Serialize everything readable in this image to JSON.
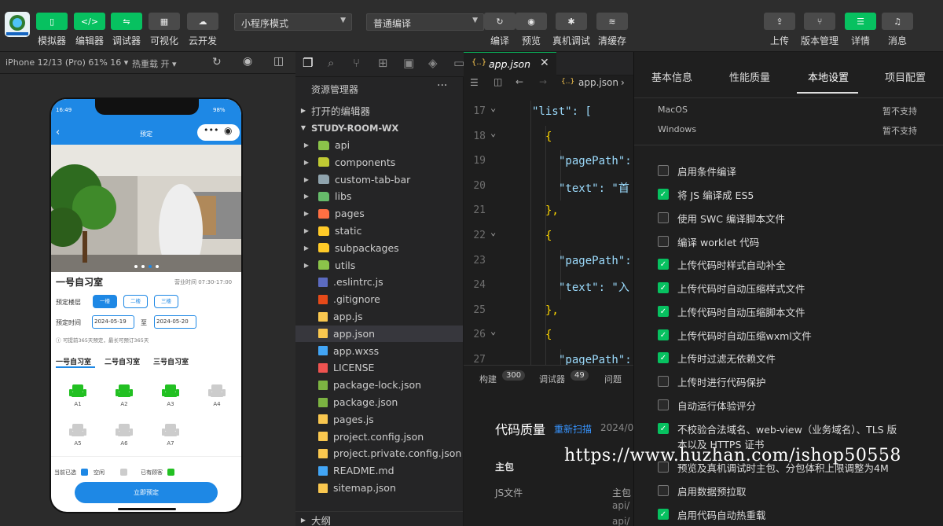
{
  "toolbar": {
    "left_buttons": [
      {
        "label": "模拟器",
        "icon": "phone-icon",
        "glyph": "▯"
      },
      {
        "label": "编辑器",
        "icon": "code-icon",
        "glyph": "</>"
      },
      {
        "label": "调试器",
        "icon": "debug-icon",
        "glyph": "⇋"
      },
      {
        "label": "可视化",
        "icon": "layout-icon",
        "glyph": "▦"
      },
      {
        "label": "云开发",
        "icon": "cloud-icon",
        "glyph": "☁"
      }
    ],
    "mode_select": "小程序模式",
    "compile_select": "普通编译",
    "mid_buttons": [
      {
        "label": "编译",
        "icon": "refresh-icon",
        "glyph": "↻"
      },
      {
        "label": "预览",
        "icon": "eye-icon",
        "glyph": "◉"
      },
      {
        "label": "真机调试",
        "icon": "bug-icon",
        "glyph": "✱"
      },
      {
        "label": "清缓存",
        "icon": "layers-icon",
        "glyph": "≋"
      }
    ],
    "right_buttons": [
      {
        "label": "上传",
        "icon": "upload-icon",
        "glyph": "⇪"
      },
      {
        "label": "版本管理",
        "icon": "branch-icon",
        "glyph": "⑂"
      },
      {
        "label": "详情",
        "icon": "menu-icon",
        "glyph": "☰"
      },
      {
        "label": "消息",
        "icon": "bell-icon",
        "glyph": "♫"
      }
    ]
  },
  "simulator": {
    "device": "iPhone 12/13 (Pro) 61% 16 ▾",
    "hot_reload": "热重载 开 ▾",
    "phone": {
      "time": "16:49",
      "battery": "98%",
      "nav_title": "预定",
      "room_name": "一号自习室",
      "hours": "营业时间 07:30-17:00",
      "floor_label": "预定楼层",
      "floors": [
        "一楼",
        "二楼",
        "三楼"
      ],
      "time_label": "预定时间",
      "date_from": "2024-05-19",
      "date_to_sep": "至",
      "date_to": "2024-05-20",
      "tip": "可提前365天预定，最长可预订365天",
      "room_tabs": [
        "一号自习室",
        "二号自习室",
        "三号自习室"
      ],
      "seats": [
        {
          "id": "A1",
          "state": "mine"
        },
        {
          "id": "A2",
          "state": "mine"
        },
        {
          "id": "A3",
          "state": "mine"
        },
        {
          "id": "A4",
          "state": "free"
        },
        {
          "id": "A5",
          "state": "free"
        },
        {
          "id": "A6",
          "state": "free"
        },
        {
          "id": "A7",
          "state": "free"
        }
      ],
      "legend": [
        "当前已选",
        "空闲",
        "已有顾客"
      ],
      "book_button": "立即预定",
      "colors": {
        "selected": "#1e88e5",
        "free": "#cccccc",
        "occupied": "#22c022"
      }
    }
  },
  "activity_icons": [
    "files-icon",
    "search-icon",
    "source-control-icon",
    "extensions-icon",
    "database-icon",
    "docker-icon",
    "terminal-icon"
  ],
  "explorer": {
    "title": "资源管理器",
    "open_editors": "打开的编辑器",
    "root": "STUDY-ROOM-WX",
    "items": [
      {
        "name": "api",
        "type": "folder",
        "color": "#8bc34a"
      },
      {
        "name": "components",
        "type": "folder",
        "color": "#c0ca33"
      },
      {
        "name": "custom-tab-bar",
        "type": "folder",
        "color": "#90a4ae"
      },
      {
        "name": "libs",
        "type": "folder",
        "color": "#66bb6a"
      },
      {
        "name": "pages",
        "type": "folder",
        "color": "#ff7043"
      },
      {
        "name": "static",
        "type": "folder",
        "color": "#ffca28"
      },
      {
        "name": "subpackages",
        "type": "folder",
        "color": "#ffca28"
      },
      {
        "name": "utils",
        "type": "folder",
        "color": "#8bc34a"
      },
      {
        "name": ".eslintrc.js",
        "type": "file",
        "color": "#5c6bc0"
      },
      {
        "name": ".gitignore",
        "type": "file",
        "color": "#e64a19"
      },
      {
        "name": "app.js",
        "type": "file",
        "color": "#f9c74f"
      },
      {
        "name": "app.json",
        "type": "file",
        "color": "#f9c74f",
        "selected": true
      },
      {
        "name": "app.wxss",
        "type": "file",
        "color": "#42a5f5"
      },
      {
        "name": "LICENSE",
        "type": "file",
        "color": "#ef5350"
      },
      {
        "name": "package-lock.json",
        "type": "file",
        "color": "#7cb342"
      },
      {
        "name": "package.json",
        "type": "file",
        "color": "#7cb342"
      },
      {
        "name": "pages.js",
        "type": "file",
        "color": "#f9c74f"
      },
      {
        "name": "project.config.json",
        "type": "file",
        "color": "#f9c74f"
      },
      {
        "name": "project.private.config.json",
        "type": "file",
        "color": "#f9c74f"
      },
      {
        "name": "README.md",
        "type": "file",
        "color": "#42a5f5"
      },
      {
        "name": "sitemap.json",
        "type": "file",
        "color": "#f9c74f"
      }
    ],
    "outline": "大纲"
  },
  "editor": {
    "tab": "app.json",
    "breadcrumb": "app.json",
    "lines": [
      {
        "n": "17",
        "text": "\"list\": ["
      },
      {
        "n": "18",
        "text": "  {"
      },
      {
        "n": "19",
        "text": "    \"pagePath\":"
      },
      {
        "n": "20",
        "text": "    \"text\": \"首"
      },
      {
        "n": "21",
        "text": "  },"
      },
      {
        "n": "22",
        "text": "  {"
      },
      {
        "n": "23",
        "text": "    \"pagePath\":"
      },
      {
        "n": "24",
        "text": "    \"text\": \"入"
      },
      {
        "n": "25",
        "text": "  },"
      },
      {
        "n": "26",
        "text": "  {"
      },
      {
        "n": "27",
        "text": "    \"pagePath\":"
      }
    ]
  },
  "bottom_panel": {
    "tabs": [
      {
        "label": "构建",
        "count": "300"
      },
      {
        "label": "调试器",
        "count": "49"
      },
      {
        "label": "问题",
        "count": ""
      }
    ],
    "title": "代码质量",
    "rescan": "重新扫描",
    "date": "2024/0",
    "main_pkg": "主包",
    "js_file": "JS文件",
    "col_main": "主包",
    "path1": "api/",
    "path2": "api/"
  },
  "settings": {
    "tabs": [
      "基本信息",
      "性能质量",
      "本地设置",
      "项目配置"
    ],
    "active_tab": "本地设置",
    "os_rows": [
      {
        "os": "MacOS",
        "status": "暂不支持"
      },
      {
        "os": "Windows",
        "status": "暂不支持"
      }
    ],
    "options": [
      {
        "label": "启用条件编译",
        "checked": false
      },
      {
        "label": "将 JS 编译成 ES5",
        "checked": true
      },
      {
        "label": "使用 SWC 编译脚本文件",
        "checked": false
      },
      {
        "label": "编译 worklet 代码",
        "checked": false
      },
      {
        "label": "上传代码时样式自动补全",
        "checked": true
      },
      {
        "label": "上传代码时自动压缩样式文件",
        "checked": true
      },
      {
        "label": "上传代码时自动压缩脚本文件",
        "checked": true
      },
      {
        "label": "上传代码时自动压缩wxml文件",
        "checked": true
      },
      {
        "label": "上传时过滤无依赖文件",
        "checked": true
      },
      {
        "label": "上传时进行代码保护",
        "checked": false
      },
      {
        "label": "自动运行体验评分",
        "checked": false
      },
      {
        "label": "不校验合法域名、web-view（业务域名）、TLS 版本以及 HTTPS 证书",
        "checked": true
      },
      {
        "label": "预览及真机调试时主包、分包体积上限调整为4M",
        "checked": false
      },
      {
        "label": "启用数据预拉取",
        "checked": false
      },
      {
        "label": "启用代码自动热重载",
        "checked": true
      }
    ]
  },
  "watermark": "https://www.huzhan.com/ishop50558"
}
